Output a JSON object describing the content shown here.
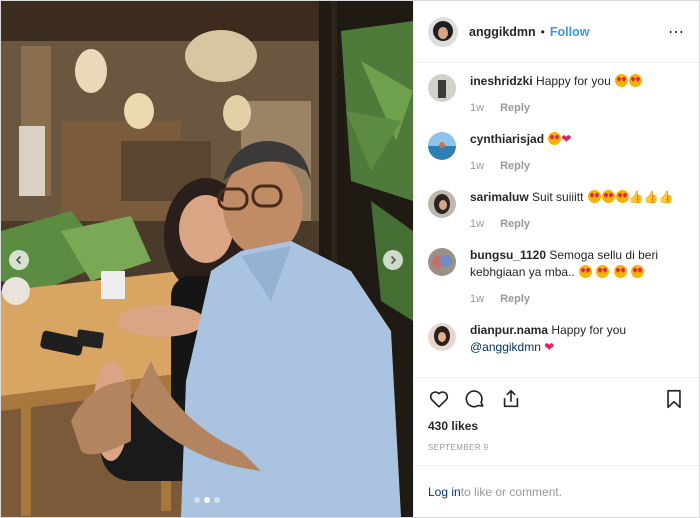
{
  "header": {
    "username": "anggikdmn",
    "separator": "•",
    "follow_label": "Follow",
    "more_label": "⋯"
  },
  "comments": [
    {
      "username": "ineshridzki",
      "text": "Happy for you",
      "emoji": [
        "heart-eyes",
        "heart-eyes"
      ],
      "time": "1w",
      "reply_label": "Reply"
    },
    {
      "username": "cynthiarisjad",
      "text": "",
      "emoji": [
        "heart-eyes",
        "red-heart"
      ],
      "time": "1w",
      "reply_label": "Reply"
    },
    {
      "username": "sarimaluw",
      "text": "Suit suiiitt",
      "emoji": [
        "heart-eyes",
        "heart-eyes",
        "heart-eyes",
        "thumbs-up",
        "thumbs-up",
        "thumbs-up"
      ],
      "time": "1w",
      "reply_label": "Reply"
    },
    {
      "username": "bungsu_1120",
      "text": "Semoga sellu di beri kebhgiaan ya mba..",
      "emoji": [
        "heart-eyes",
        "heart-eyes",
        "heart-eyes",
        "heart-eyes"
      ],
      "time": "1w",
      "reply_label": "Reply"
    },
    {
      "username": "dianpur.nama",
      "text": "Happy for you",
      "mention": "@anggikdmn",
      "emoji": [
        "red-heart"
      ]
    }
  ],
  "actions": {
    "like_icon": "heart-outline-icon",
    "comment_icon": "comment-bubble-icon",
    "share_icon": "share-icon",
    "save_icon": "bookmark-icon"
  },
  "likes": "430 likes",
  "date": "SEPTEMBER 9",
  "login": {
    "link": "Log in",
    "rest": " to like or comment."
  },
  "carousel": {
    "slides": 3,
    "active": 1
  },
  "colors": {
    "accent": "#3897f0",
    "link": "#003569",
    "muted": "#999999",
    "border": "#efefef"
  }
}
